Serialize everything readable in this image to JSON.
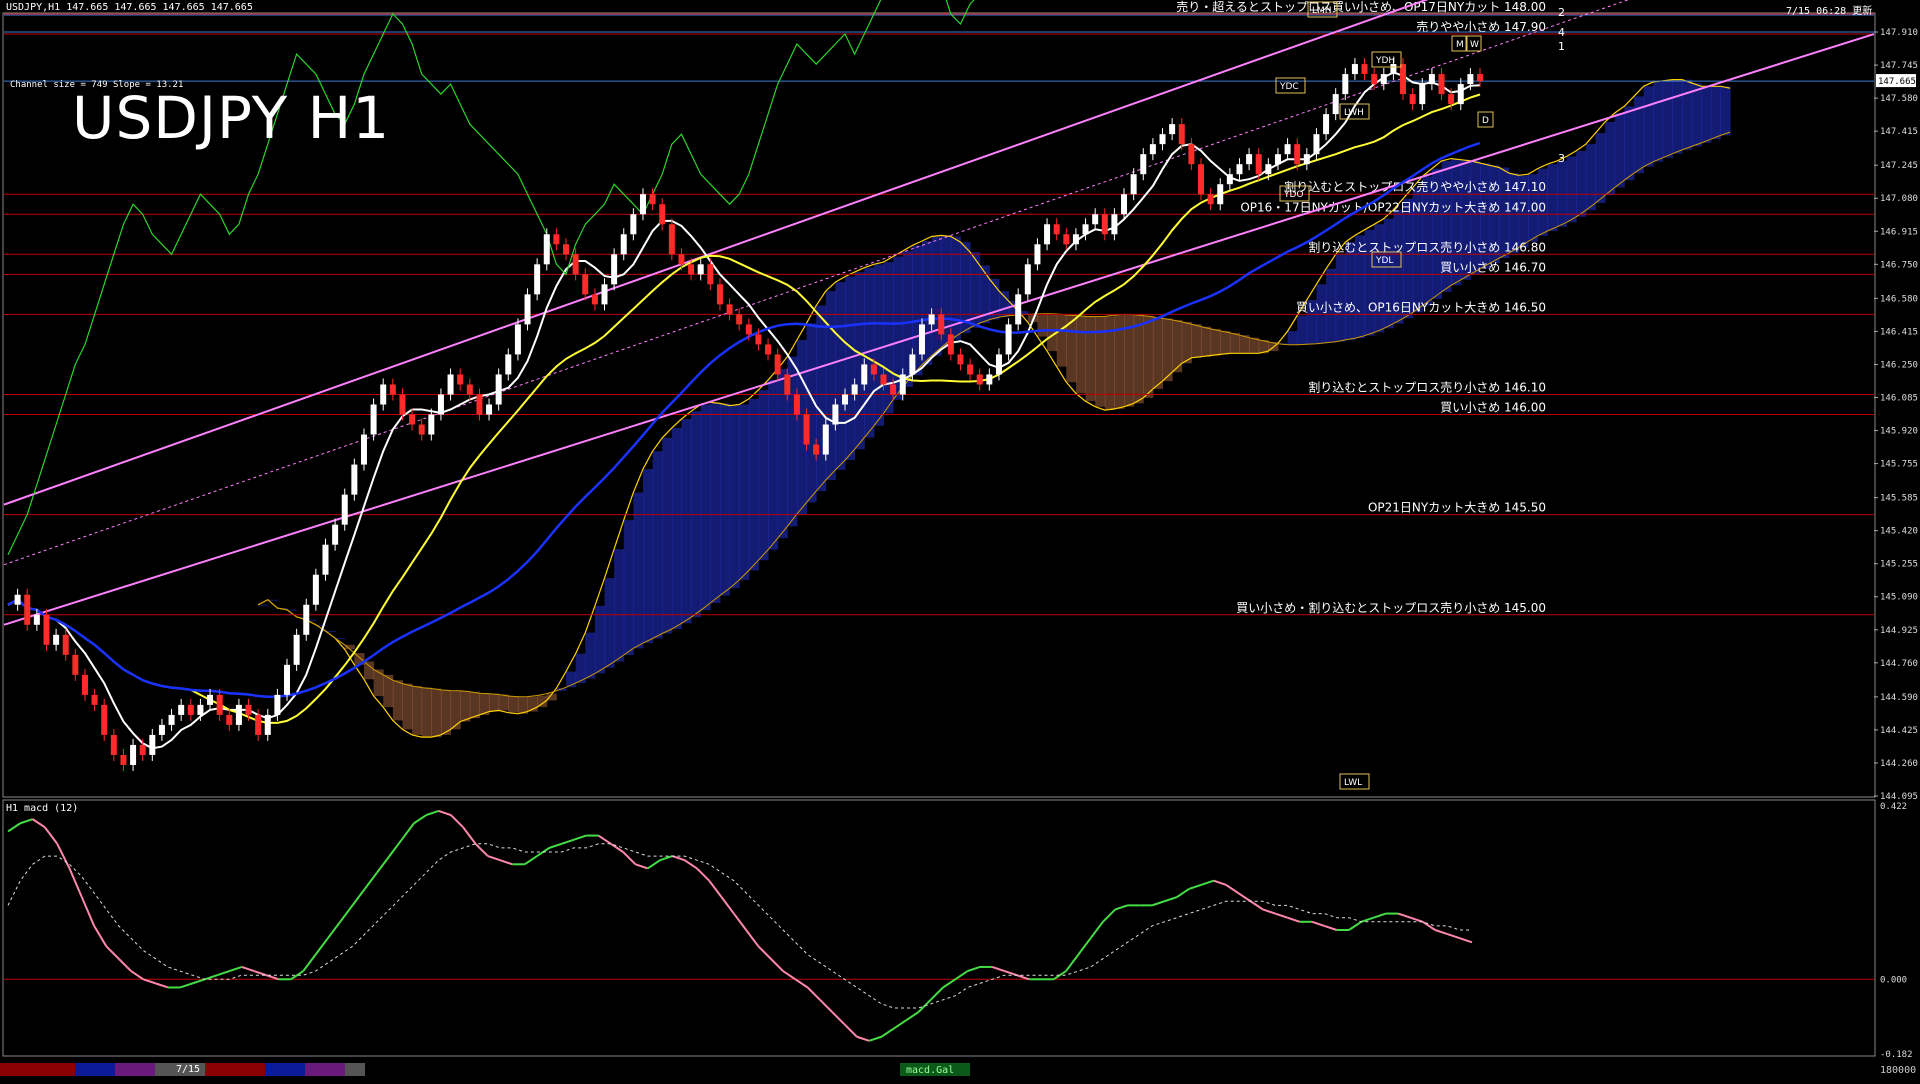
{
  "header": {
    "symbol_line": "USDJPY,H1  147.665 147.665 147.665 147.665",
    "datetime": "7/15 06:28 更新",
    "channel_info": "Channel size = 749 Slope = 13.21",
    "big_title": "USDJPY H1",
    "macd_label": "H1  macd (12)"
  },
  "colors": {
    "background": "#000000",
    "bull_candle": "#ffffff",
    "bear_candle": "#ff2a2a",
    "channel_line": "#ff80ff",
    "level_line": "#c00000",
    "kumo_bull": "#2a3cff",
    "kumo_bear": "#ff9a60",
    "span_a": "#ffd000",
    "ma_fast": "#ffffff",
    "ma_mid": "#ffff33",
    "ma_slow": "#1a32ff",
    "chikou": "#2bd42b",
    "macd_up": "#44dd44",
    "macd_down": "#ff88aa",
    "macd_signal": "#dddddd"
  },
  "chart_data": {
    "type": "line",
    "title": "USDJPY H1",
    "ylim": [
      144.095,
      148.0
    ],
    "price_ticks": [
      147.91,
      147.745,
      147.58,
      147.415,
      147.245,
      147.08,
      146.915,
      146.75,
      146.58,
      146.415,
      146.25,
      146.085,
      145.92,
      145.755,
      145.585,
      145.42,
      145.255,
      145.09,
      144.925,
      144.76,
      144.59,
      144.425,
      144.26,
      144.095
    ],
    "current_price": 147.665,
    "levels": [
      {
        "price": 148.0,
        "label": "売り・超えるとストップロス買い小さめ、OP17日NYカット 148.00"
      },
      {
        "price": 147.9,
        "label": "売りやや小さめ 147.90"
      },
      {
        "price": 147.1,
        "label": "割り込むとストップロス売りやや小さめ 147.10"
      },
      {
        "price": 147.0,
        "label": "OP16・17日NYカット/OP22日NYカット大きめ 147.00"
      },
      {
        "price": 146.8,
        "label": "割り込むとストップロス売り小さめ 146.80"
      },
      {
        "price": 146.7,
        "label": "買い小さめ 146.70"
      },
      {
        "price": 146.5,
        "label": "買い小さめ、OP16日NYカット大きめ 146.50"
      },
      {
        "price": 146.1,
        "label": "割り込むとストップロス売り小さめ 146.10"
      },
      {
        "price": 146.0,
        "label": "買い小さめ 146.00"
      },
      {
        "price": 145.5,
        "label": "OP21日NYカット大きめ 145.50"
      },
      {
        "price": 145.0,
        "label": "買い小さめ・割り込むとストップロス売り小さめ 145.00"
      }
    ],
    "projection_labels": [
      "2",
      "4",
      "1",
      "3"
    ],
    "marker_labels": [
      "YDH",
      "YDC",
      "YDO",
      "YDL",
      "LWH",
      "LWL",
      "LMH",
      "M",
      "W",
      "D"
    ],
    "series": [
      {
        "values": [
          145.05,
          145.1,
          144.95,
          145.0,
          144.85,
          144.9,
          144.8,
          144.7,
          144.6,
          144.55,
          144.4,
          144.3,
          144.25,
          144.35,
          144.3,
          144.4,
          144.45,
          144.5,
          144.55,
          144.5,
          144.55,
          144.6,
          144.5,
          144.45,
          144.55,
          144.5,
          144.4,
          144.5,
          144.6,
          144.75,
          144.9,
          145.05,
          145.2,
          145.35,
          145.45,
          145.6,
          145.75,
          145.9,
          146.05,
          146.15,
          146.1,
          146.0,
          145.95,
          145.9,
          146.0,
          146.1,
          146.2,
          146.15,
          146.1,
          146.0,
          146.05,
          146.2,
          146.3,
          146.45,
          146.6,
          146.75,
          146.9,
          146.85,
          146.8,
          146.7,
          146.6,
          146.55,
          146.65,
          146.8,
          146.9,
          147.0,
          147.1,
          147.05,
          146.95,
          146.8,
          146.75,
          146.7,
          146.75,
          146.65,
          146.55,
          146.5,
          146.45,
          146.4,
          146.35,
          146.3,
          146.2,
          146.1,
          146.0,
          145.85,
          145.8,
          145.95,
          146.05,
          146.1,
          146.15,
          146.25,
          146.2,
          146.15,
          146.1,
          146.2,
          146.3,
          146.45,
          146.5,
          146.4,
          146.3,
          146.25,
          146.2,
          146.15,
          146.2,
          146.3,
          146.45,
          146.6,
          146.75,
          146.85,
          146.95,
          146.9,
          146.85,
          146.9,
          146.95,
          147.0,
          146.9,
          147.0,
          147.1,
          147.2,
          147.3,
          147.35,
          147.4,
          147.45,
          147.35,
          147.25,
          147.1,
          147.05,
          147.15,
          147.2,
          147.25,
          147.3,
          147.2,
          147.25,
          147.3,
          147.35,
          147.25,
          147.3,
          147.4,
          147.5,
          147.6,
          147.7,
          147.75,
          147.7,
          147.65,
          147.7,
          147.75,
          147.6,
          147.55,
          147.65,
          147.7,
          147.6,
          147.55,
          147.65,
          147.7,
          147.665
        ]
      }
    ],
    "macd": {
      "ylim": [
        -0.182,
        0.422
      ],
      "ticks": [
        0.422,
        0.0,
        -0.182
      ],
      "values": [
        0.36,
        0.38,
        0.39,
        0.37,
        0.33,
        0.27,
        0.2,
        0.13,
        0.08,
        0.05,
        0.02,
        0.0,
        -0.01,
        -0.02,
        -0.02,
        -0.01,
        0.0,
        0.01,
        0.02,
        0.03,
        0.02,
        0.01,
        0.0,
        0.0,
        0.02,
        0.06,
        0.1,
        0.14,
        0.18,
        0.22,
        0.26,
        0.3,
        0.34,
        0.38,
        0.4,
        0.41,
        0.4,
        0.37,
        0.33,
        0.3,
        0.29,
        0.28,
        0.28,
        0.3,
        0.32,
        0.33,
        0.34,
        0.35,
        0.35,
        0.33,
        0.31,
        0.28,
        0.27,
        0.29,
        0.3,
        0.29,
        0.27,
        0.24,
        0.2,
        0.16,
        0.12,
        0.08,
        0.05,
        0.02,
        0.0,
        -0.02,
        -0.05,
        -0.08,
        -0.11,
        -0.14,
        -0.15,
        -0.14,
        -0.12,
        -0.1,
        -0.08,
        -0.05,
        -0.02,
        0.0,
        0.02,
        0.03,
        0.03,
        0.02,
        0.01,
        0.0,
        0.0,
        0.0,
        0.02,
        0.06,
        0.1,
        0.14,
        0.17,
        0.18,
        0.18,
        0.18,
        0.19,
        0.2,
        0.22,
        0.23,
        0.24,
        0.23,
        0.21,
        0.19,
        0.17,
        0.16,
        0.15,
        0.14,
        0.14,
        0.13,
        0.12,
        0.12,
        0.14,
        0.15,
        0.16,
        0.16,
        0.15,
        0.14,
        0.12,
        0.11,
        0.1,
        0.09
      ],
      "signal": [
        0.18,
        0.24,
        0.28,
        0.3,
        0.3,
        0.28,
        0.25,
        0.21,
        0.17,
        0.13,
        0.1,
        0.07,
        0.05,
        0.03,
        0.02,
        0.01,
        0.0,
        0.0,
        0.0,
        0.01,
        0.01,
        0.01,
        0.01,
        0.01,
        0.01,
        0.02,
        0.04,
        0.06,
        0.08,
        0.11,
        0.14,
        0.17,
        0.2,
        0.23,
        0.26,
        0.29,
        0.31,
        0.32,
        0.33,
        0.33,
        0.32,
        0.32,
        0.31,
        0.31,
        0.31,
        0.31,
        0.32,
        0.32,
        0.33,
        0.33,
        0.32,
        0.31,
        0.3,
        0.3,
        0.3,
        0.3,
        0.29,
        0.28,
        0.26,
        0.24,
        0.21,
        0.18,
        0.15,
        0.12,
        0.09,
        0.06,
        0.04,
        0.02,
        0.0,
        -0.02,
        -0.04,
        -0.06,
        -0.07,
        -0.07,
        -0.07,
        -0.06,
        -0.05,
        -0.04,
        -0.02,
        -0.01,
        0.0,
        0.01,
        0.01,
        0.01,
        0.01,
        0.01,
        0.01,
        0.02,
        0.03,
        0.05,
        0.07,
        0.09,
        0.11,
        0.13,
        0.14,
        0.15,
        0.16,
        0.17,
        0.18,
        0.19,
        0.19,
        0.19,
        0.19,
        0.18,
        0.18,
        0.17,
        0.16,
        0.16,
        0.15,
        0.15,
        0.14,
        0.14,
        0.14,
        0.14,
        0.14,
        0.14,
        0.13,
        0.13,
        0.12,
        0.12
      ]
    }
  },
  "bottom_bar": {
    "date_label": "7/15",
    "indicator_label": "macd.Gal",
    "right_value": "180000"
  }
}
